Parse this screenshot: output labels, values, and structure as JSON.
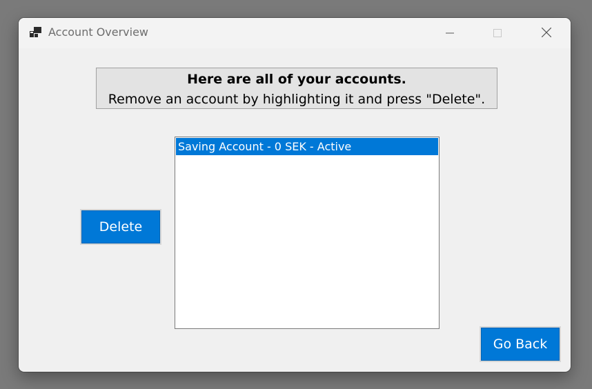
{
  "window": {
    "title": "Account Overview",
    "icon": "window-app-icon"
  },
  "caption_buttons": {
    "minimize_icon": "minimize-icon",
    "maximize_icon": "maximize-icon",
    "close_icon": "close-icon"
  },
  "info": {
    "line1": "Here are all of your accounts.",
    "line2": "Remove an account by highlighting it and press \"Delete\"."
  },
  "accounts": {
    "items": [
      {
        "label": "Saving Account - 0 SEK - Active",
        "selected": true
      }
    ]
  },
  "buttons": {
    "delete_label": "Delete",
    "go_back_label": "Go Back"
  },
  "colors": {
    "accent": "#0078d7",
    "window_bg": "#f0f0f0",
    "desktop_bg": "#7a7a7a"
  }
}
